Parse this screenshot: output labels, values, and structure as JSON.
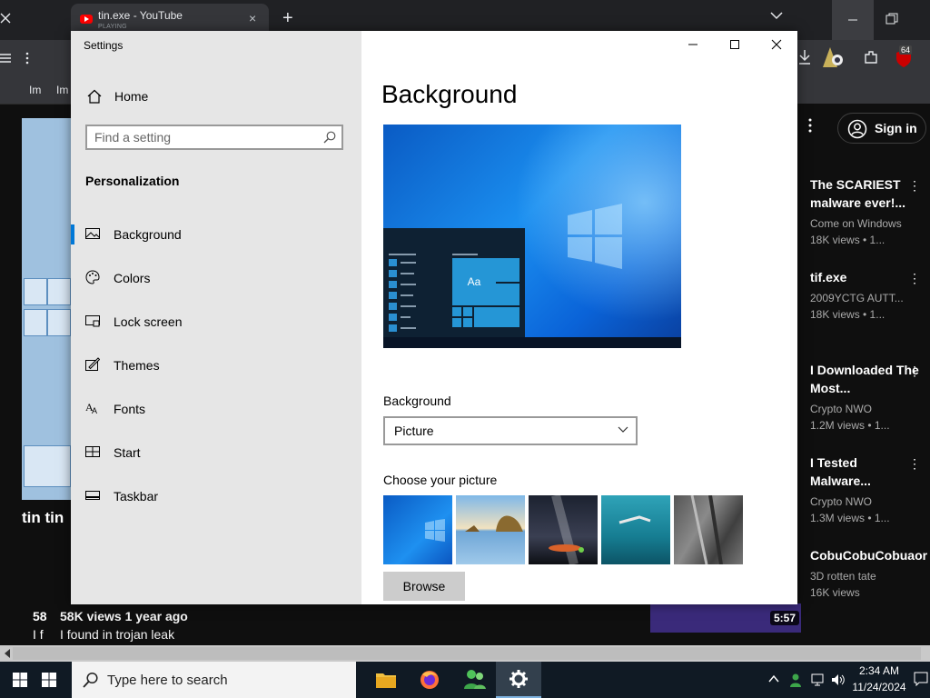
{
  "browser": {
    "tab": {
      "title": "tin.exe - YouTube",
      "subtitle": "PLAYING",
      "close_glyph": "×"
    },
    "new_tab_glyph": "+",
    "bookmarks": [
      "Im",
      "Im"
    ],
    "extension_badge": "64"
  },
  "page": {
    "left_strip_text": "tin tin",
    "views_left": "58",
    "views_line": "58K views  1 year ago",
    "desc_left": "I f",
    "desc_line": "I found in trojan leak"
  },
  "sidebar": {
    "signin_label": "Sign in",
    "videos": [
      {
        "title": "The SCARIEST malware ever!...",
        "channel": "Come on Windows",
        "meta": "18K views • 1..."
      },
      {
        "title": "tif.exe",
        "channel": "2009YCTG AUTT...",
        "meta": "18K views • 1..."
      },
      {
        "title": "I Downloaded The Most...",
        "channel": "Crypto NWO",
        "meta": "1.2M views • 1..."
      },
      {
        "title": "I Tested Malware...",
        "channel": "Crypto NWO",
        "meta": "1.3M views • 1..."
      },
      {
        "title": "CobuCobuCobuaoris.e",
        "channel": "3D rotten tate",
        "meta": "16K views"
      }
    ],
    "thumb_duration": "5:57"
  },
  "settings": {
    "app_title": "Settings",
    "home_label": "Home",
    "search_placeholder": "Find a setting",
    "section_title": "Personalization",
    "nav_items": [
      {
        "label": "Background",
        "icon": "picture-icon",
        "selected": true
      },
      {
        "label": "Colors",
        "icon": "palette-icon",
        "selected": false
      },
      {
        "label": "Lock screen",
        "icon": "lock-screen-icon",
        "selected": false
      },
      {
        "label": "Themes",
        "icon": "themes-icon",
        "selected": false
      },
      {
        "label": "Fonts",
        "icon": "fonts-icon",
        "selected": false
      },
      {
        "label": "Start",
        "icon": "start-icon",
        "selected": false
      },
      {
        "label": "Taskbar",
        "icon": "taskbar-icon",
        "selected": false
      }
    ],
    "page_title": "Background",
    "preview_tile_text": "Aa",
    "background_label": "Background",
    "background_value": "Picture",
    "choose_label": "Choose your picture",
    "browse_label": "Browse",
    "accent_color": "#0078d7"
  },
  "taskbar": {
    "search_placeholder": "Type here to search",
    "time": "2:34 AM",
    "date": "11/24/2024",
    "color": "#101a24"
  }
}
